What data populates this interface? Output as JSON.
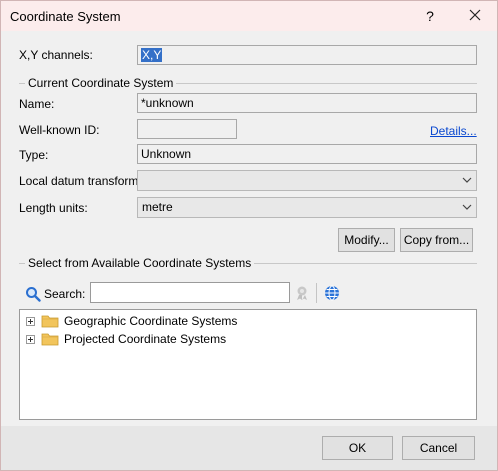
{
  "window": {
    "title": "Coordinate System",
    "help_label": "?"
  },
  "channels": {
    "label": "X,Y channels:",
    "value": "X,Y"
  },
  "current": {
    "group_label": "Current Coordinate System",
    "name_label": "Name:",
    "name_value": "*unknown",
    "wkid_label": "Well-known ID:",
    "wkid_value": "",
    "details_link": "Details...",
    "type_label": "Type:",
    "type_value": "Unknown",
    "datum_label": "Local datum transform:",
    "datum_value": "",
    "units_label": "Length units:",
    "units_value": "metre",
    "modify_button": "Modify...",
    "copy_button": "Copy from..."
  },
  "available": {
    "group_label": "Select from Available Coordinate Systems",
    "search_label": "Search:",
    "search_value": "",
    "tree": [
      {
        "label": "Geographic Coordinate Systems"
      },
      {
        "label": "Projected Coordinate Systems"
      }
    ]
  },
  "footer": {
    "ok_label": "OK",
    "cancel_label": "Cancel"
  },
  "colors": {
    "title_bg": "#fcecec",
    "selection": "#3470c8",
    "link": "#0a48d0",
    "folder": "#f2c55c"
  }
}
